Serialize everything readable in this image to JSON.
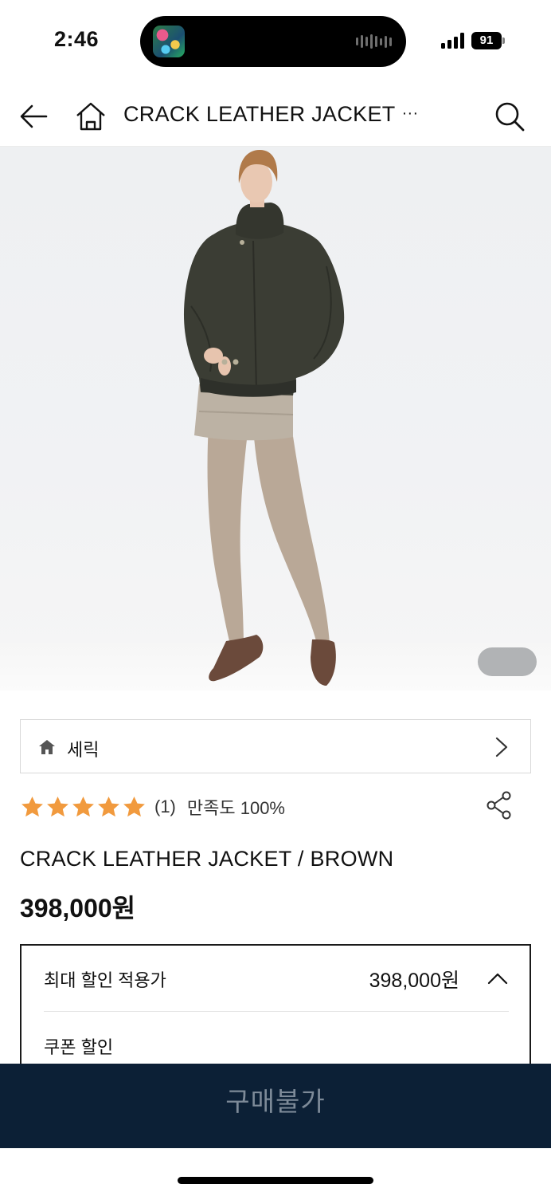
{
  "status_bar": {
    "time": "2:46",
    "battery": "91"
  },
  "header": {
    "title": "CRACK LEATHER JACKET",
    "title_ellipsis": "···",
    "back_icon": "arrow-left-icon",
    "home_icon": "home-icon",
    "search_icon": "search-icon"
  },
  "product_image": {
    "alt": "Model wearing dark olive crack leather jacket",
    "jacket_color": "#3b3d34",
    "skirt_color": "#bcb2a4",
    "tights_color": "#b9a897"
  },
  "brand": {
    "name": "세릭",
    "icon": "home-icon"
  },
  "rating": {
    "stars": 5,
    "star_color": "#f19a3e",
    "review_count": "(1)",
    "satisfaction": "만족도 100%"
  },
  "product": {
    "name": "CRACK LEATHER JACKET / BROWN",
    "price": "398,000원"
  },
  "discount": {
    "label": "최대 할인 적용가",
    "value": "398,000원",
    "coupon_label": "쿠폰 할인"
  },
  "buy_button": {
    "label": "구매불가",
    "background": "#0c2036"
  }
}
